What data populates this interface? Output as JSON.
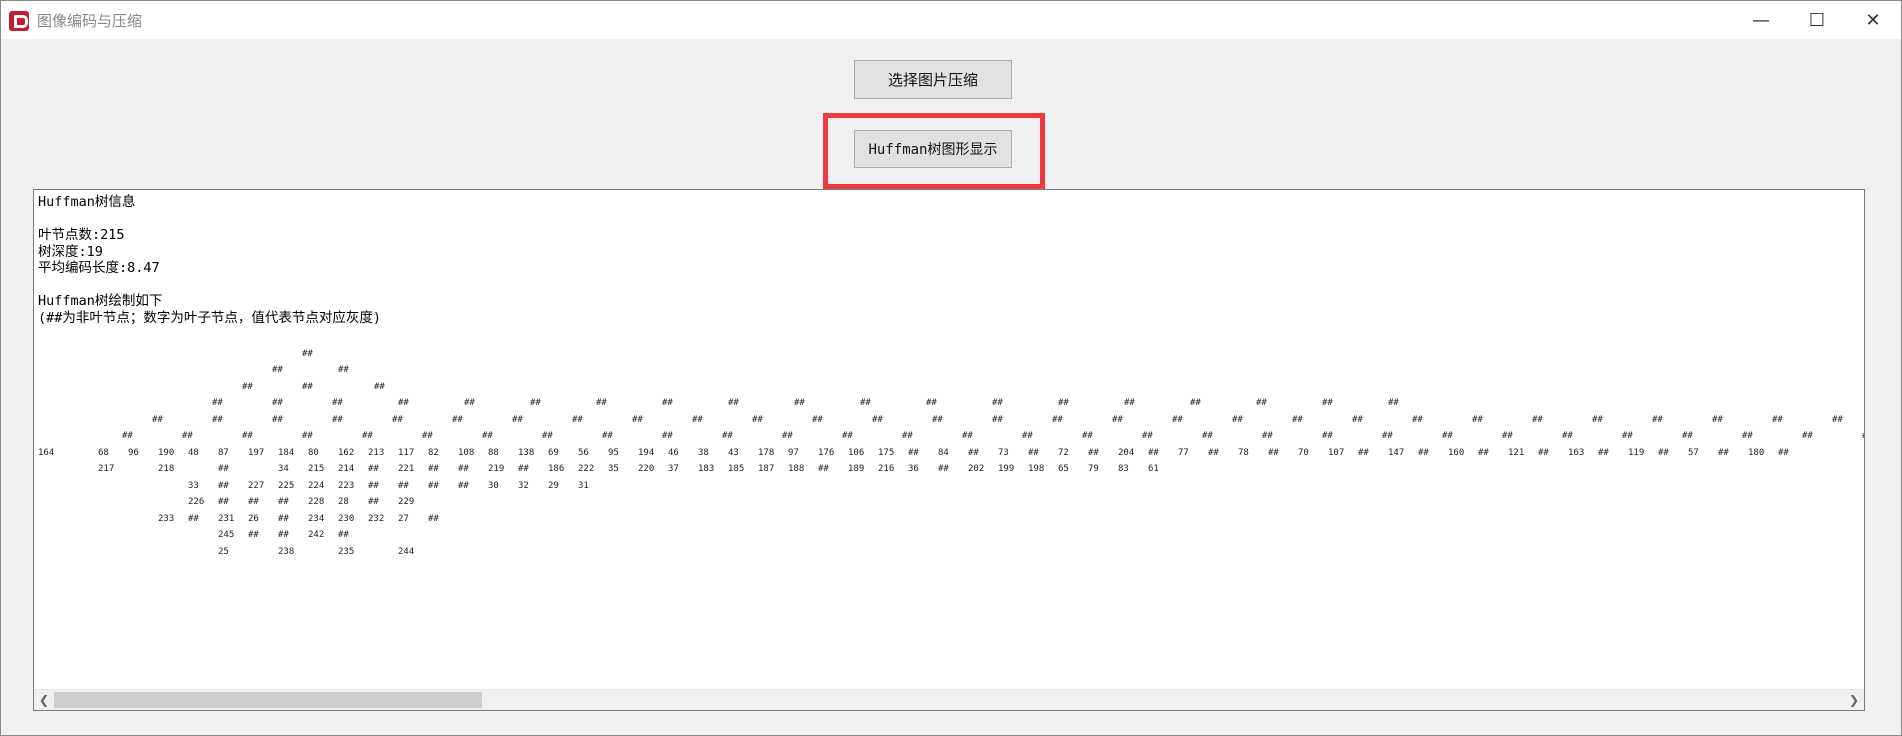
{
  "window": {
    "title": "图像编码与压缩",
    "controls": {
      "minimize": "—",
      "maximize": "☐",
      "close": "✕"
    }
  },
  "buttons": {
    "compress_label": "选择图片压缩",
    "huffman_label": "Huffman树图形显示"
  },
  "output": {
    "text_lines": [
      "Huffman树信息",
      "",
      "叶节点数:215",
      "树深度:19",
      "平均编码长度:8.47",
      "",
      "Huffman树绘制如下",
      "(##为非叶节点；数字为叶子节点，值代表节点对应灰度)"
    ],
    "tree_rows": [
      "",
      "                                            ##",
      "                                       ##         ##",
      "                                  ##        ##          ##",
      "                             ##        ##        ##         ##         ##         ##         ##         ##         ##         ##         ##         ##         ##         ##         ##         ##         ##         ##         ##",
      "                   ##        ##        ##        ##        ##        ##        ##        ##        ##        ##        ##        ##        ##        ##        ##        ##        ##        ##        ##        ##        ##        ##        ##        ##        ##        ##        ##        ##        ##        ##        ##        ##        ##        ##        ##        ##        ##        ##        ##        ##        ##        ##        ##        ##        ##        ##        ##        ##        ##        ##        ##",
      "              ##        ##        ##        ##        ##        ##        ##        ##        ##        ##        ##        ##        ##        ##        ##        ##        ##        ##        ##        ##        ##        ##        ##        ##        ##        ##        ##        ##        ##        ##        ##        ##        ##        ##        ##        ##        ##        ##        ##        ##        ##        ##        ##        ##        ##        ##        ##        ##        ##        ##        ##        ##        ##        ##        ##        ##        ##        ##        ##        ##        ##        ##",
      "164       68   96   190  48   87   197  184  80   162  213  117  82   108  88   138  69   56   95   194  46   38   43   178  97   176  106  175  ##   84   ##   73   ##   72   ##   204  ##   77   ##   78   ##   70   107  ##   147  ##   160  ##   121  ##   163  ##   119  ##   57   ##   180  ##",
      "          217       218       ##        34   215  214  ##   221  ##   ##   219  ##   186  222  35   220  37   183  185  187  188  ##   189  216  36   ##   202  199  198  65   79   83   61",
      "                         33   ##   227  225  224  223  ##   ##   ##   ##   30   32   29   31",
      "                         226  ##   ##   ##   228  28   ##   229",
      "                    233  ##   231  26   ##   234  230  232  27   ##",
      "                              245  ##   ##   242  ##",
      "                              25        238       235       244"
    ]
  }
}
